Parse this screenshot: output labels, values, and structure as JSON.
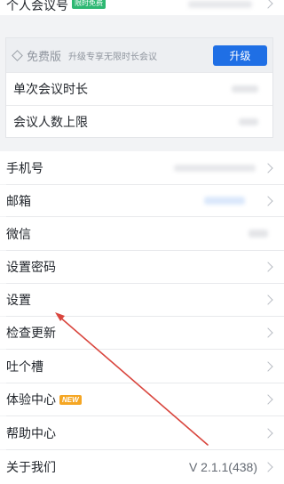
{
  "account": {
    "personal_meeting_id_label": "个人会议号",
    "personal_meeting_id_badge": "限时免费"
  },
  "plan": {
    "name": "免费版",
    "promo": "升级专享无限时长会议",
    "upgrade_label": "升级",
    "rows": [
      {
        "label": "单次会议时长"
      },
      {
        "label": "会议人数上限"
      }
    ]
  },
  "settings": {
    "phone_label": "手机号",
    "email_label": "邮箱",
    "wechat_label": "微信",
    "set_password_label": "设置密码",
    "settings_label": "设置",
    "check_update_label": "检查更新",
    "feedback_label": "吐个槽",
    "experience_center_label": "体验中心",
    "experience_center_badge": "NEW",
    "help_center_label": "帮助中心",
    "about_label": "关于我们",
    "version_value": "V 2.1.1(438)"
  },
  "colors": {
    "accent": "#1f6fe5",
    "badge_green": "#2eb872",
    "badge_orange": "#f5a623",
    "annotation_arrow": "#d9463e"
  }
}
